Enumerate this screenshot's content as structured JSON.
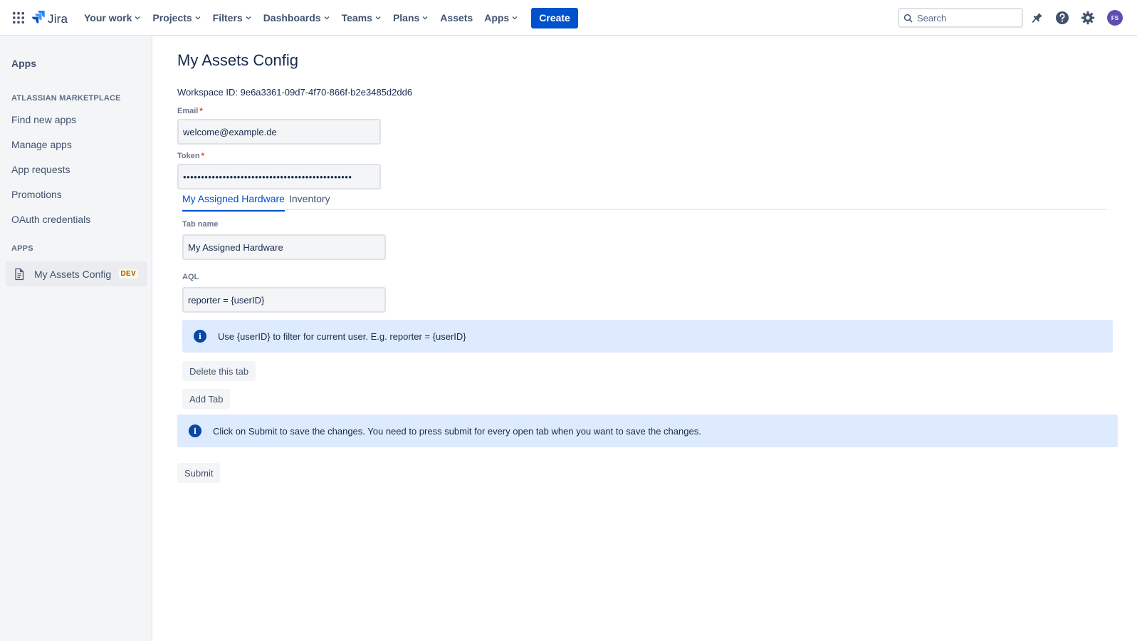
{
  "header": {
    "app_name": "Jira",
    "nav": [
      {
        "label": "Your work",
        "has_dropdown": true
      },
      {
        "label": "Projects",
        "has_dropdown": true
      },
      {
        "label": "Filters",
        "has_dropdown": true
      },
      {
        "label": "Dashboards",
        "has_dropdown": true
      },
      {
        "label": "Teams",
        "has_dropdown": true
      },
      {
        "label": "Plans",
        "has_dropdown": true
      },
      {
        "label": "Assets",
        "has_dropdown": false
      },
      {
        "label": "Apps",
        "has_dropdown": true
      }
    ],
    "create_label": "Create",
    "search_placeholder": "Search",
    "avatar_initials": "FS",
    "icons": [
      "app-switcher-icon",
      "jira-logo-icon",
      "search-icon",
      "notifications-icon",
      "help-icon",
      "settings-icon"
    ]
  },
  "sidebar": {
    "title": "Apps",
    "marketplace_section": "ATLASSIAN MARKETPLACE",
    "marketplace_items": [
      "Find new apps",
      "Manage apps",
      "App requests",
      "Promotions",
      "OAuth credentials"
    ],
    "apps_section": "APPS",
    "app_item": {
      "label": "My Assets Config",
      "badge": "DEV",
      "icon": "page-icon"
    }
  },
  "main": {
    "title": "My Assets Config",
    "workspace": "Workspace ID: 9e6a3361-09d7-4f70-866f-b2e3485d2dd6",
    "email_label": "Email",
    "email_value": "welcome@example.de",
    "token_label": "Token",
    "token_value": "•••••••••••••••••••••••••••••••••••••••••••••••",
    "required_marker": "*",
    "tabs": [
      {
        "label": "My Assigned Hardware",
        "active": true
      },
      {
        "label": "Inventory",
        "active": false
      }
    ],
    "tab_name_label": "Tab name",
    "tab_name_value": "My Assigned Hardware",
    "aql_label": "AQL",
    "aql_value": "reporter = {userID}",
    "aql_hint": "Use {userID} to filter for current user. E.g. reporter = {userID}",
    "delete_tab_label": "Delete this tab",
    "add_tab_label": "Add Tab",
    "submit_info": "Click on Submit to save the changes. You need to press submit for every open tab when you want to save the changes.",
    "submit_label": "Submit",
    "info_glyph": "i"
  },
  "colors": {
    "primary": "#0052cc",
    "info_bg": "#deebff",
    "avatar": "#5e4db2",
    "required": "#de350b"
  }
}
